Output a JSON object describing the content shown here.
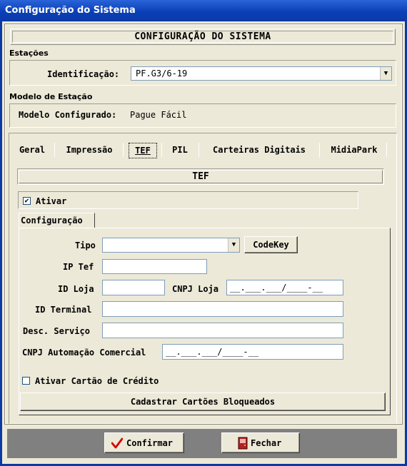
{
  "window": {
    "title": "Configuração do Sistema"
  },
  "header": {
    "title": "CONFIGURAÇÃO DO SISTEMA"
  },
  "stations": {
    "section": "Estações",
    "id_label": "Identificação:",
    "id_value": "PF.G3/6-19"
  },
  "model": {
    "section": "Modelo de Estação",
    "label": "Modelo Configurado:",
    "value": "Pague Fácil"
  },
  "tabs": [
    "Geral",
    "Impressão",
    "TEF",
    "PIL",
    "Carteiras Digitais",
    "MidiaPark"
  ],
  "active_tab": "TEF",
  "tef": {
    "title": "TEF",
    "activate_label": "Ativar",
    "activate_checked": true,
    "subtab": "Configuração",
    "tipo_label": "Tipo",
    "tipo_value": "",
    "codekey_button": "CodeKey",
    "ip_label": "IP Tef",
    "ip_value": "",
    "idloja_label": "ID Loja",
    "idloja_value": "",
    "cnpjloja_label": "CNPJ Loja",
    "cnpjloja_mask": "__.___.___/____-__",
    "idterminal_label": "ID Terminal",
    "idterminal_value": "",
    "descservico_label": "Desc. Serviço",
    "descservico_value": "",
    "cnpjauto_label": "CNPJ Automação Comercial",
    "cnpjauto_mask": "__.___.___/____-__",
    "credit_label": "Ativar Cartão de Crédito",
    "credit_checked": false,
    "blocked_button": "Cadastrar Cartões Bloqueados"
  },
  "footer": {
    "confirm": "Confirmar",
    "close": "Fechar"
  },
  "colors": {
    "titlebar": "#0b3aa6",
    "confirm_icon": "#d40000",
    "close_icon": "#b22222"
  }
}
